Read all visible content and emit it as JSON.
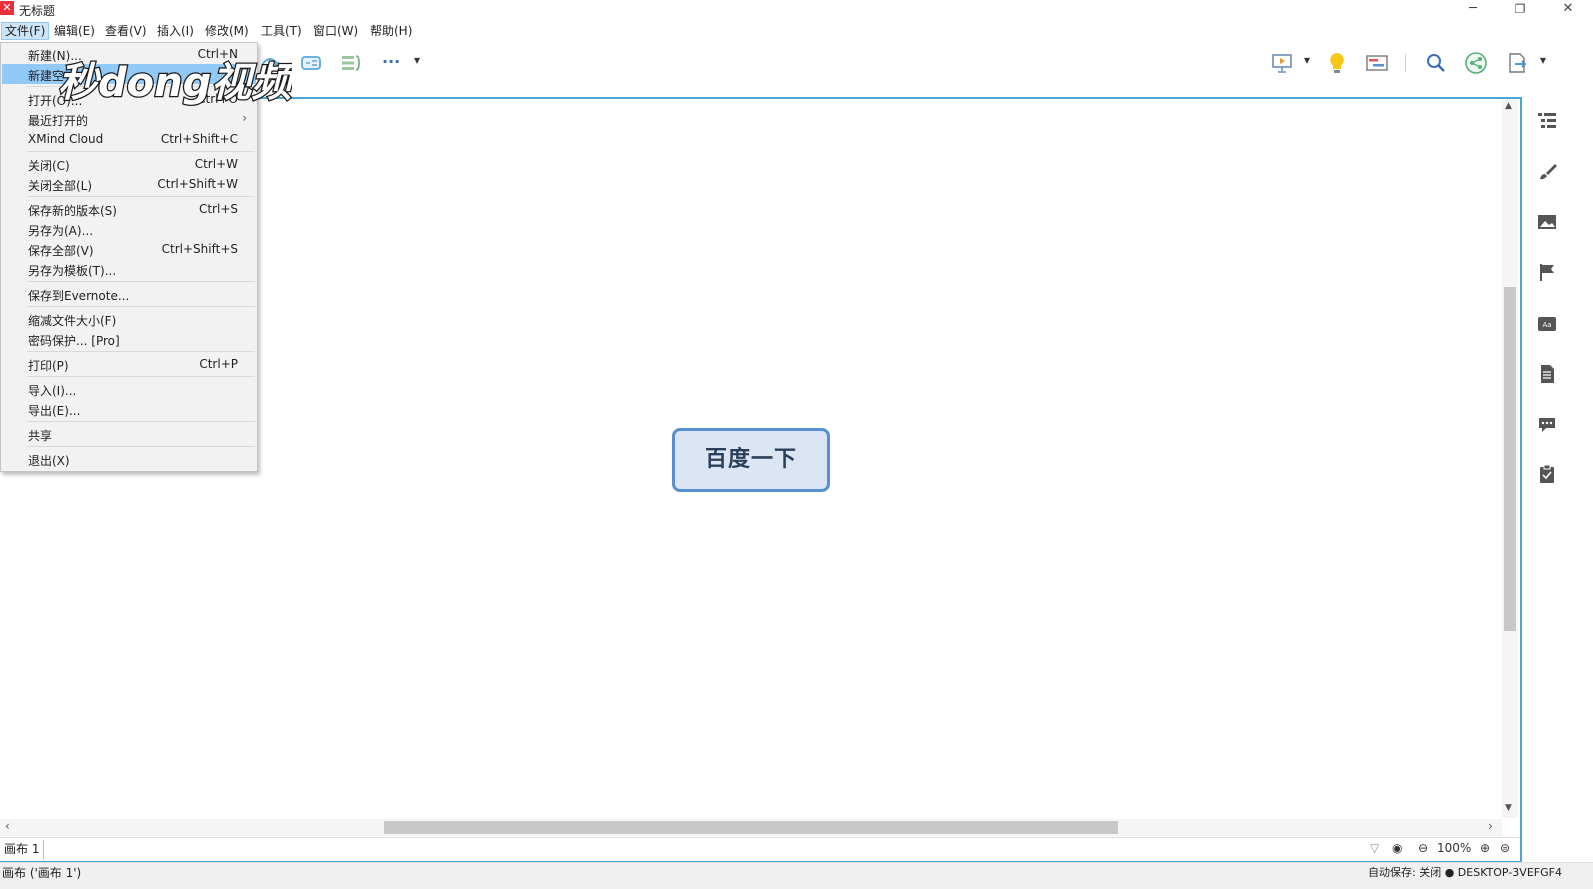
{
  "window": {
    "title": "无标题",
    "minimize": "─",
    "maximize": "❐",
    "close": "✕"
  },
  "menubar": [
    "文件(F)",
    "编辑(E)",
    "查看(V)",
    "插入(I)",
    "修改(M)",
    "工具(T)",
    "窗口(W)",
    "帮助(H)"
  ],
  "file_menu": {
    "items": [
      {
        "label": "新建(N)...",
        "shortcut": "Ctrl+N"
      },
      {
        "label": "新建空",
        "shortcut": ""
      },
      {
        "label": "打开(O)...",
        "shortcut": "Ctrl+O"
      },
      {
        "label": "最近打开的",
        "shortcut": "",
        "submenu": "›"
      },
      {
        "label": "XMind Cloud",
        "shortcut": "Ctrl+Shift+C"
      },
      {
        "label": "关闭(C)",
        "shortcut": "Ctrl+W"
      },
      {
        "label": "关闭全部(L)",
        "shortcut": "Ctrl+Shift+W"
      },
      {
        "label": "保存新的版本(S)",
        "shortcut": "Ctrl+S"
      },
      {
        "label": "另存为(A)...",
        "shortcut": ""
      },
      {
        "label": "保存全部(V)",
        "shortcut": "Ctrl+Shift+S"
      },
      {
        "label": "另存为模板(T)...",
        "shortcut": ""
      },
      {
        "label": "保存到Evernote...",
        "shortcut": ""
      },
      {
        "label": "缩减文件大小(F)",
        "shortcut": ""
      },
      {
        "label": "密码保护... [Pro]",
        "shortcut": ""
      },
      {
        "label": "打印(P)",
        "shortcut": "Ctrl+P"
      },
      {
        "label": "导入(I)...",
        "shortcut": ""
      },
      {
        "label": "导出(E)...",
        "shortcut": ""
      },
      {
        "label": "共享",
        "shortcut": ""
      },
      {
        "label": "退出(X)",
        "shortcut": ""
      }
    ]
  },
  "watermark": "秒dong视频",
  "toolbar": {
    "more": "···",
    "dropdown": "▾"
  },
  "canvas": {
    "central_topic": "百度一下"
  },
  "sheet": {
    "tab": "画布 1",
    "zoom": "100%"
  },
  "statusbar": {
    "left": "画布 ('画布 1')",
    "right": "自动保存: 关闭  ● DESKTOP-3VEFGF4"
  },
  "colors": {
    "accent": "#4aa6d8",
    "topic_fill": "#dbe5f3",
    "topic_border": "#5b8fd3",
    "highlight": "#91c9f7"
  }
}
